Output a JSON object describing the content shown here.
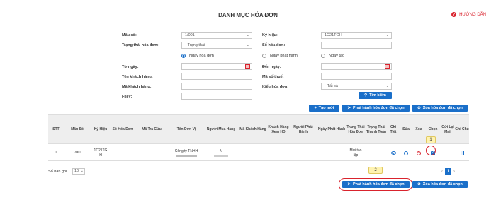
{
  "header": {
    "title": "DANH MỤC HÓA ĐƠN",
    "help_label": "HƯỚNG DẪN"
  },
  "filters": {
    "mau_so": {
      "label": "Mẫu số:",
      "value": "1/001"
    },
    "trang_thai": {
      "label": "Trạng thái hóa đơn:",
      "value": "--Trạng thái--"
    },
    "ky_hieu": {
      "label": "Ký hiệu:",
      "value": "1C21TGH"
    },
    "so_hoa_don": {
      "label": "Số hóa đơn:",
      "value": ""
    },
    "date_mode": {
      "options": [
        "Ngày hóa đơn",
        "Ngày phát hành",
        "Ngày tạo"
      ],
      "selected": "Ngày hóa đơn"
    },
    "tu_ngay": {
      "label": "Từ ngày:",
      "value": ""
    },
    "den_ngay": {
      "label": "Đến ngày:",
      "value": ""
    },
    "ten_khach_hang": {
      "label": "Tên khách hàng:",
      "value": ""
    },
    "ma_so_thue": {
      "label": "Mã số thuế:",
      "value": ""
    },
    "ma_khach_hang": {
      "label": "Mã khách hàng:",
      "value": ""
    },
    "kieu_hoa_don": {
      "label": "Kiểu hóa đơn:",
      "value": "--Tất cả--"
    },
    "fkey": {
      "label": "Fkey:",
      "value": ""
    },
    "search_button": "Tìm kiếm"
  },
  "toolbar": {
    "create": "Tạo mới",
    "issue_selected": "Phát hành hóa đơn đã chọn",
    "delete_selected": "Xóa hóa đơn đã chọn"
  },
  "table": {
    "columns": [
      "STT",
      "Mẫu Số",
      "Ký Hiệu",
      "Số Hóa Đơn",
      "Mã Tra Cứu",
      "Tên Đơn Vị",
      "Người Mua Hàng",
      "Mã Khách Hàng",
      "Khách Hàng Xem HD",
      "Người Phát Hành",
      "Ngày Phát Hành",
      "Trạng Thái Hóa Đơn",
      "Trạng Thái Thanh Toán",
      "Chi Tiết",
      "Sửa",
      "Xóa",
      "Chọn",
      "Gửi Lại Mail",
      "Ghi Chú"
    ],
    "rows": [
      {
        "stt": "1",
        "mau_so": "1/001",
        "ky_hieu": "1C21TGH",
        "so_hoa_don": "",
        "ma_tra_cuu": "",
        "ten_don_vi": "Công ty TNHH",
        "nguoi_mua_hang": "N",
        "ma_khach_hang": "",
        "khach_hang_xem_hd": "",
        "nguoi_phat_hanh": "",
        "ngay_phat_hanh": "",
        "trang_thai_hoa_don": "Mới tạo lập",
        "trang_thai_thanh_toan": "",
        "chon_checked": true
      }
    ]
  },
  "pagination": {
    "page_size_label": "Số bản ghi",
    "page_size": "10",
    "current_page": "1"
  },
  "annotations": {
    "step1": "1",
    "step2": "2"
  },
  "colors": {
    "primary": "#1a6fc9",
    "danger": "#d9232d",
    "highlight": "#fff3b0",
    "header_bg": "#eeeeee"
  }
}
